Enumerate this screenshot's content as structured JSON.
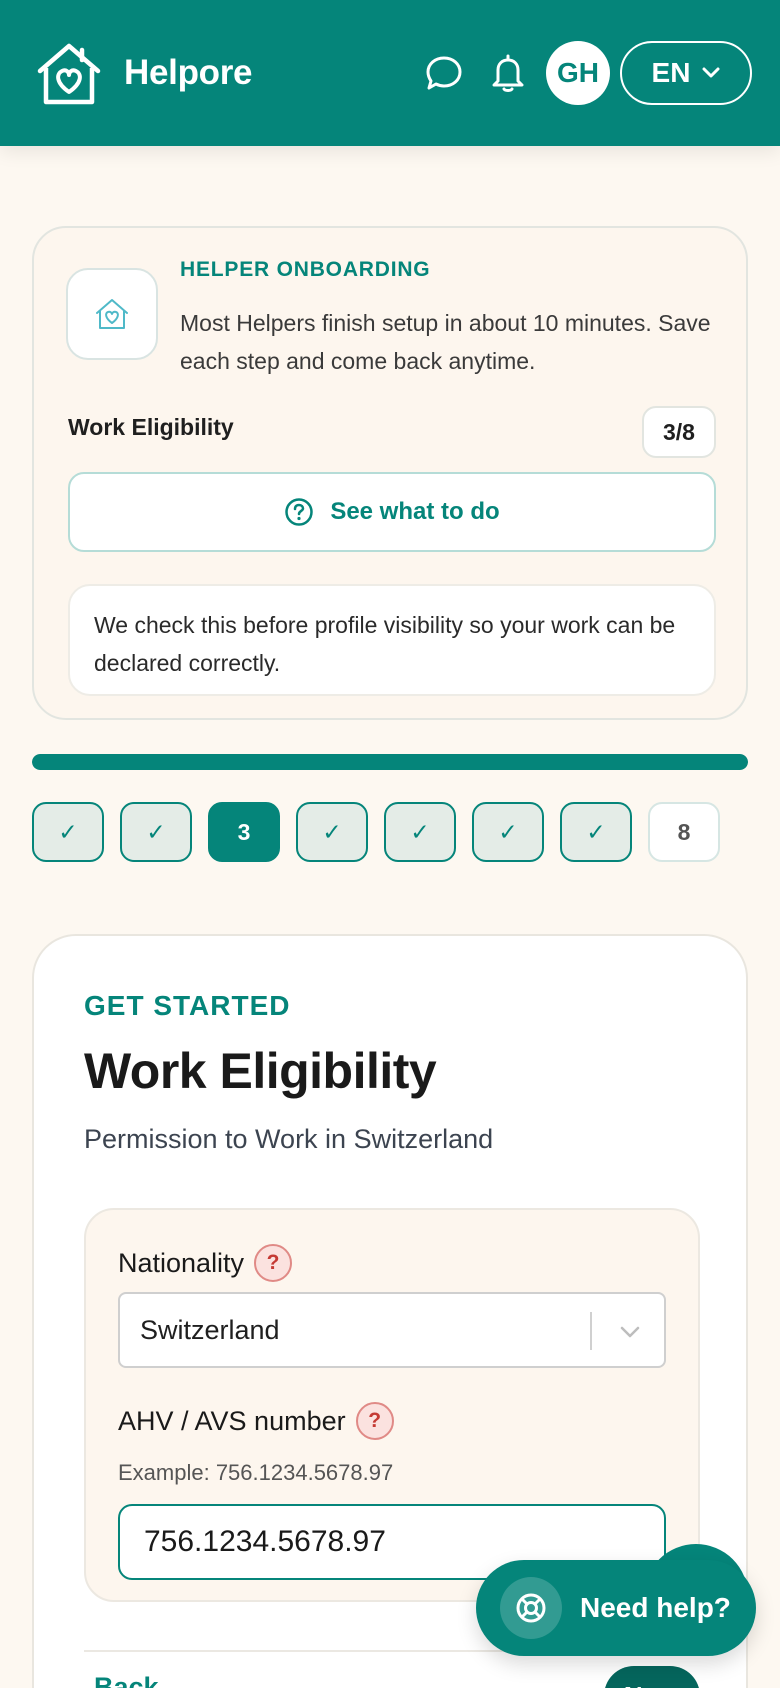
{
  "header": {
    "brand_name": "Helpore",
    "avatar_initials": "GH",
    "language": "EN",
    "icons": [
      "home-heart-logo",
      "chat-bubble-icon",
      "bell-icon",
      "chevron-down-icon"
    ]
  },
  "onboarding": {
    "eyebrow": "HELPER ONBOARDING",
    "description": "Most Helpers finish setup in about 10 minutes. Save each step and come back anytime.",
    "step_title": "Work Eligibility",
    "step_badge": "3/8",
    "see_what_to_do": "See what to do",
    "note": "We check this before profile visibility so your work can be declared correctly."
  },
  "progress": {
    "fraction": 1.0,
    "steps": [
      {
        "label": "✓",
        "state": "done"
      },
      {
        "label": "✓",
        "state": "done"
      },
      {
        "label": "3",
        "state": "current"
      },
      {
        "label": "✓",
        "state": "done"
      },
      {
        "label": "✓",
        "state": "done"
      },
      {
        "label": "✓",
        "state": "done"
      },
      {
        "label": "✓",
        "state": "done"
      },
      {
        "label": "8",
        "state": "todo"
      }
    ]
  },
  "main": {
    "eyebrow": "GET STARTED",
    "title": "Work Eligibility",
    "subtitle": "Permission to Work in Switzerland",
    "nationality": {
      "label": "Nationality",
      "help": "?",
      "value": "Switzerland"
    },
    "ahv": {
      "label": "AHV / AVS number",
      "help": "?",
      "hint": "Example: 756.1234.5678.97",
      "value": "756.1234.5678.97"
    },
    "back_label": "Back",
    "next_label": "Next"
  },
  "help_fab": {
    "label": "Need help?"
  },
  "colors": {
    "brand": "#05857a",
    "background": "#fdf8f1",
    "help_red": "#c53a34"
  }
}
